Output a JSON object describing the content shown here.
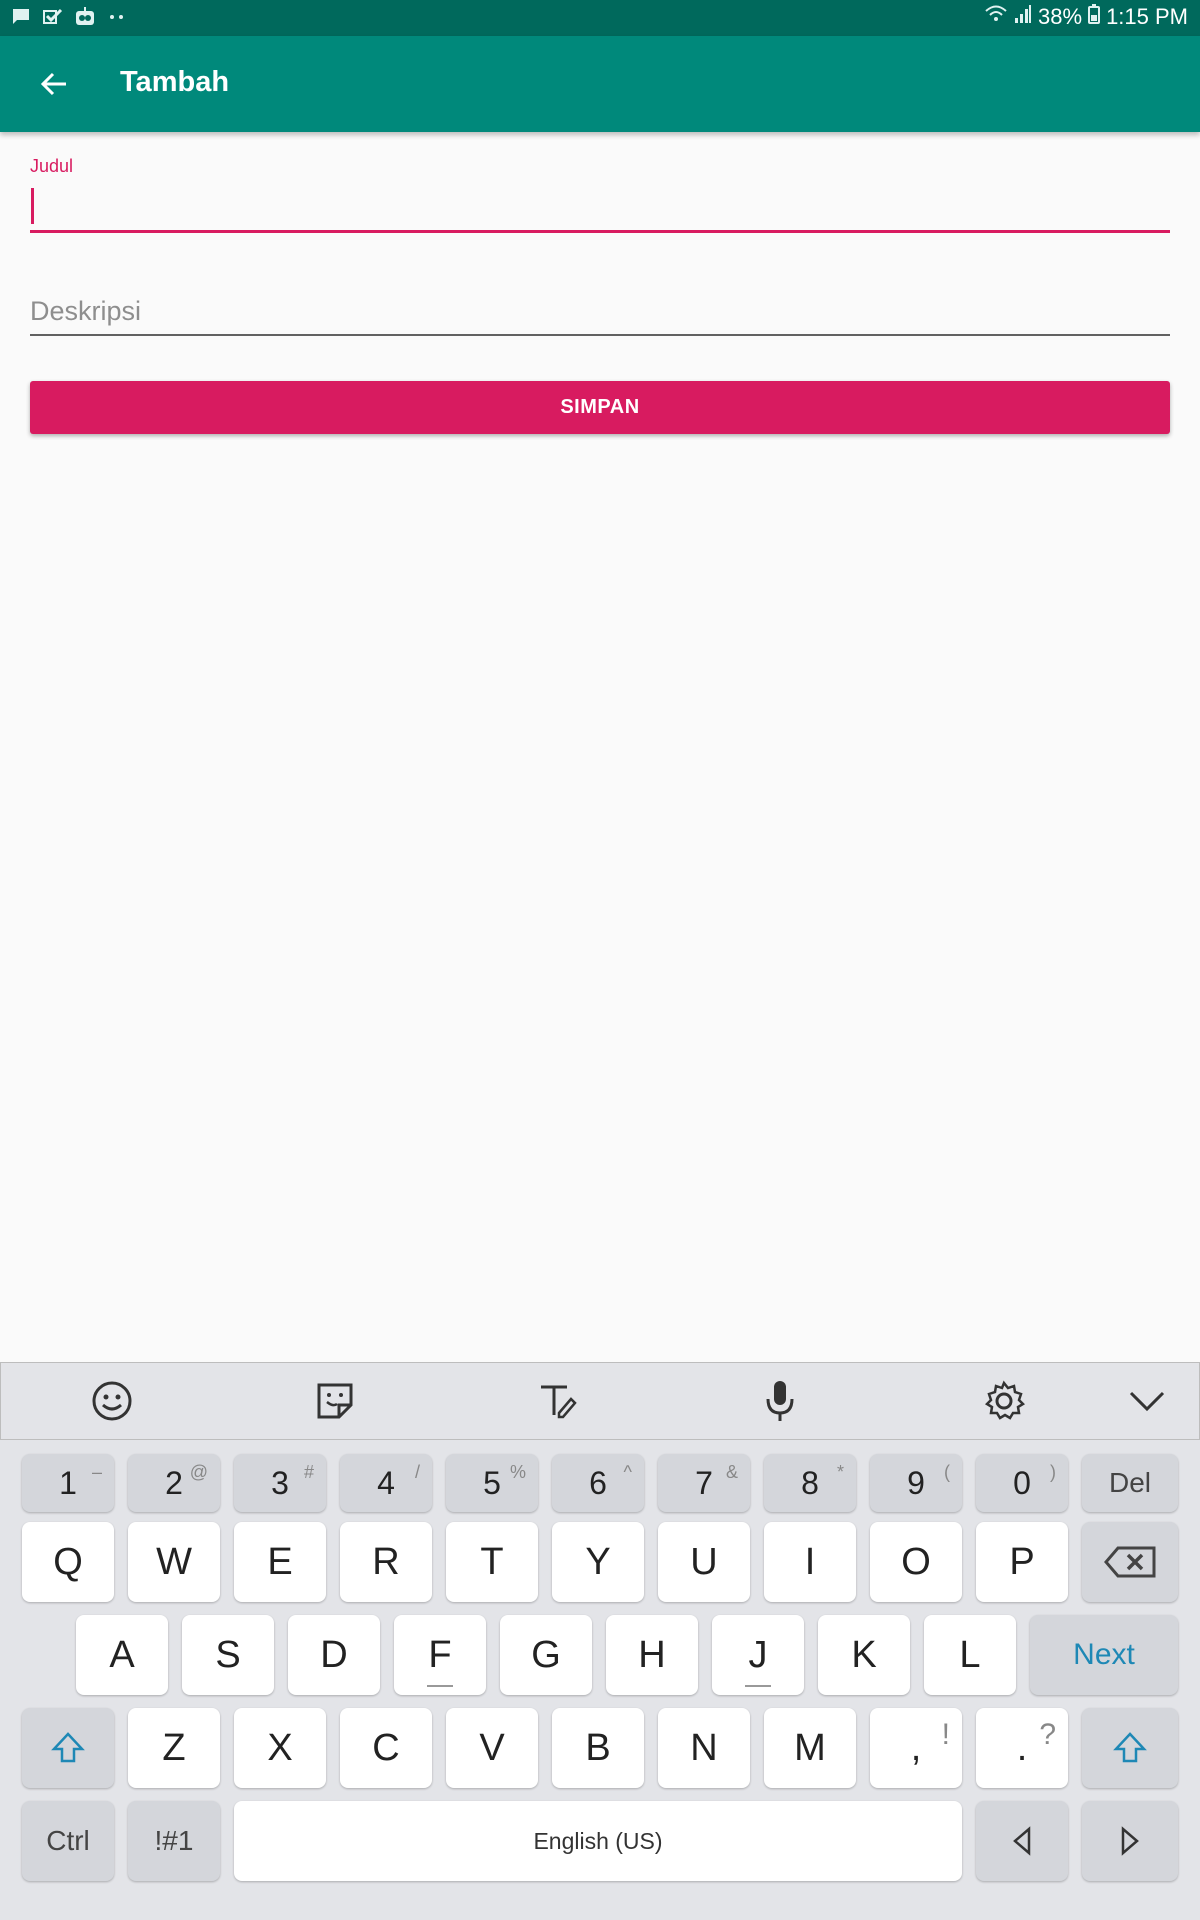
{
  "status_bar": {
    "signal_icons": [
      "message-icon",
      "checkmark-icon",
      "robot-icon",
      "more-dots-icon"
    ],
    "battery": "38%",
    "time": "1:15 PM"
  },
  "appbar": {
    "title": "Tambah"
  },
  "form": {
    "judul_label": "Judul",
    "judul_value": "",
    "deskripsi_placeholder": "Deskripsi",
    "save_label": "SIMPAN"
  },
  "keyboard": {
    "toolbar": [
      "emoji-icon",
      "sticker-icon",
      "handwriting-icon",
      "microphone-icon",
      "settings-icon",
      "collapse-icon"
    ],
    "row_numbers": [
      {
        "main": "1",
        "sec": "–"
      },
      {
        "main": "2",
        "sec": "@"
      },
      {
        "main": "3",
        "sec": "#"
      },
      {
        "main": "4",
        "sec": "/"
      },
      {
        "main": "5",
        "sec": "%"
      },
      {
        "main": "6",
        "sec": "^"
      },
      {
        "main": "7",
        "sec": "&"
      },
      {
        "main": "8",
        "sec": "*"
      },
      {
        "main": "9",
        "sec": "("
      },
      {
        "main": "0",
        "sec": ")"
      }
    ],
    "del_label": "Del",
    "row_q": [
      "Q",
      "W",
      "E",
      "R",
      "T",
      "Y",
      "U",
      "I",
      "O",
      "P"
    ],
    "row_a": [
      "A",
      "S",
      "D",
      "F",
      "G",
      "H",
      "J",
      "K",
      "L"
    ],
    "next_label": "Next",
    "row_z": [
      "Z",
      "X",
      "C",
      "V",
      "B",
      "N",
      "M"
    ],
    "comma": {
      "main": ",",
      "sec": "!"
    },
    "period": {
      "main": ".",
      "sec": "?"
    },
    "ctrl_label": "Ctrl",
    "sym_label": "!#1",
    "space_label": "English (US)",
    "colors": {
      "accent": "#d81b60",
      "appbar": "#00897b",
      "statusbar": "#00695c"
    }
  }
}
